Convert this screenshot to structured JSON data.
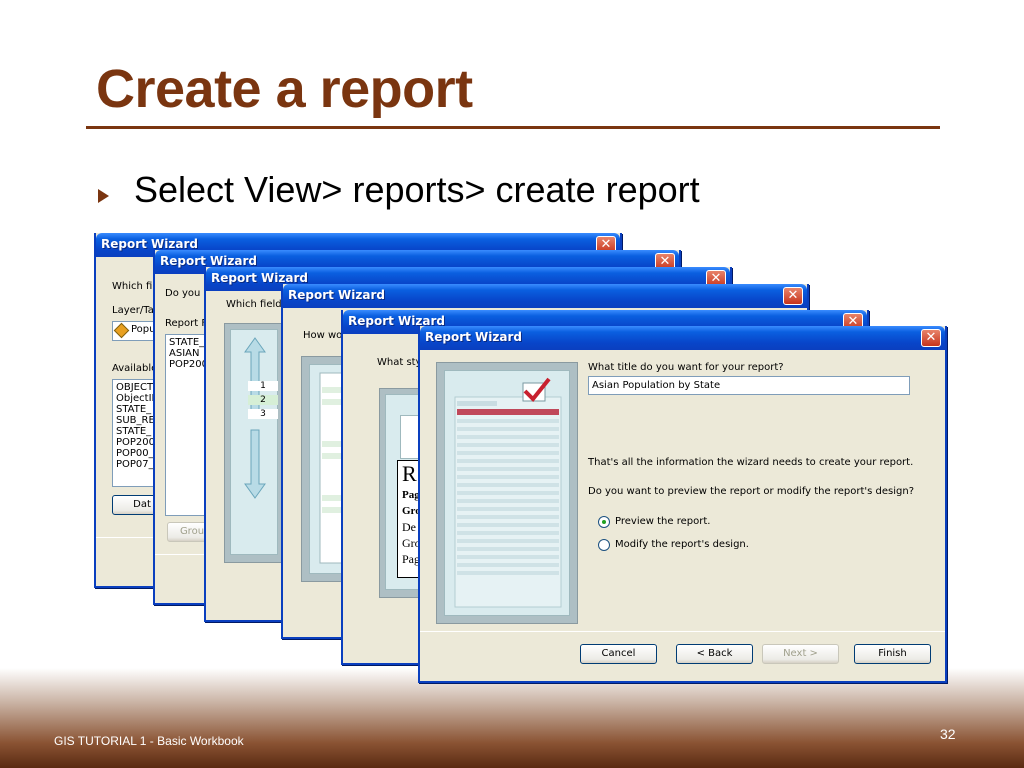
{
  "slide": {
    "title": "Create a report",
    "bullet": "Select View> reports> create report",
    "footer": "GIS TUTORIAL 1 - Basic Workbook",
    "page_number": "32"
  },
  "dialog_title": "Report Wizard",
  "close_glyph": "✕",
  "w1": {
    "q": "Which fi",
    "layer_label": "Layer/Ta",
    "layer_value": "Popu",
    "available_label": "Available",
    "fields": [
      "OBJECT",
      "ObjectID",
      "STATE_",
      "SUB_RE",
      "STATE_",
      "POP200",
      "POP00_",
      "POP07_"
    ],
    "button": "Dat"
  },
  "w2": {
    "q": "Do you w",
    "report_fields_label": "Report F",
    "fields": [
      "STATE_",
      "ASIAN",
      "POP200"
    ],
    "button": "Grou"
  },
  "w3": {
    "q": "Which fields",
    "levels": [
      "1",
      "2",
      "3"
    ]
  },
  "w4": {
    "q": "How wo"
  },
  "w5": {
    "q": "What sty",
    "sample": [
      "R",
      "Pag",
      "Gro",
      "De",
      "Gro",
      "Pag"
    ]
  },
  "w6": {
    "title_question": "What title do you want for your report?",
    "title_value": "Asian Population by State",
    "info": "That's all the information the wizard needs to create your report.",
    "preview_question": "Do you want to preview the report or modify the report's design?",
    "option_preview": "Preview the report.",
    "option_modify": "Modify the report's design.",
    "cancel": "Cancel",
    "back": "< Back",
    "next": "Next >",
    "finish": "Finish"
  },
  "colors": {
    "title": "#7a3510",
    "xp_titlebar": "#0a5fe0",
    "dialog_bg": "#ece9d8"
  }
}
